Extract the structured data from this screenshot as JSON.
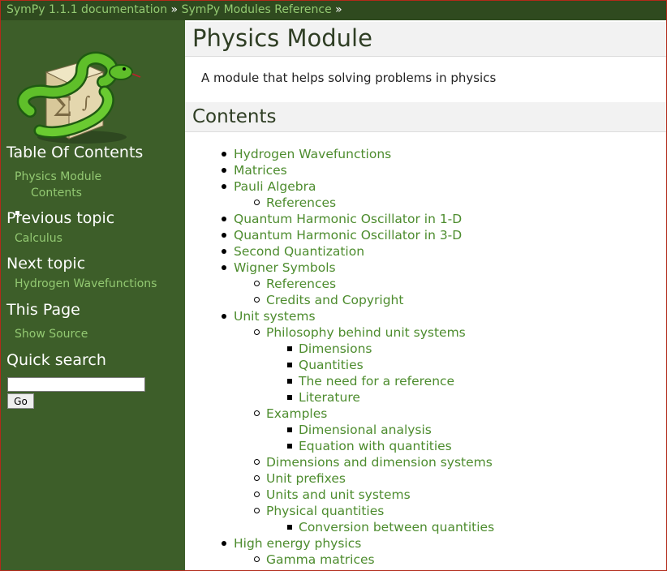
{
  "breadcrumb": {
    "items": [
      "SymPy 1.1.1 documentation",
      "SymPy Modules Reference"
    ],
    "separator": "»"
  },
  "sidebar": {
    "toc_heading": "Table Of Contents",
    "toc_link": "Physics Module",
    "toc_sub_link": "Contents",
    "prev_heading": "Previous topic",
    "prev_link": "Calculus",
    "next_heading": "Next topic",
    "next_link": "Hydrogen Wavefunctions",
    "this_page_heading": "This Page",
    "show_source": "Show Source",
    "search_heading": "Quick search",
    "search_value": "",
    "go_label": "Go"
  },
  "main": {
    "title": "Physics Module",
    "intro": "A module that helps solving problems in physics",
    "contents_heading": "Contents",
    "toc": [
      "Hydrogen Wavefunctions",
      "Matrices",
      "Pauli Algebra",
      "References",
      "Quantum Harmonic Oscillator in 1-D",
      "Quantum Harmonic Oscillator in 3-D",
      "Second Quantization",
      "Wigner Symbols",
      "References",
      "Credits and Copyright",
      "Unit systems",
      "Philosophy behind unit systems",
      "Dimensions",
      "Quantities",
      "The need for a reference",
      "Literature",
      "Examples",
      "Dimensional analysis",
      "Equation with quantities",
      "Dimensions and dimension systems",
      "Unit prefixes",
      "Units and unit systems",
      "Physical quantities",
      "Conversion between quantities",
      "High energy physics",
      "Gamma matrices"
    ]
  },
  "colors": {
    "sidebar_bg": "#3d5e29",
    "topbar_bg": "#2f4a1f",
    "link_green": "#4d8c2e",
    "sidebar_link": "#93c972",
    "window_border": "#b22a1a"
  }
}
